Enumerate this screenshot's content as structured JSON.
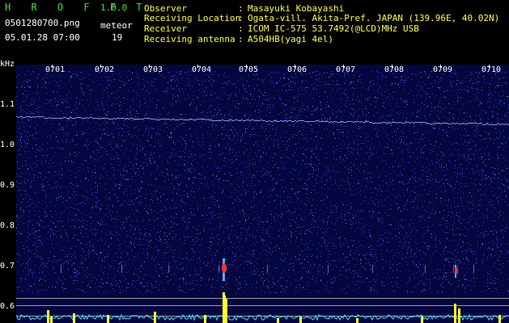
{
  "header": {
    "app_title": "H R O F F T",
    "version": "1.0.0",
    "filename": "0501280700.png",
    "datetime": "05.01.28 07:00",
    "meteor_label": "meteor",
    "meteor_count": "19",
    "fields": [
      {
        "label": "Observer",
        "sep": ":",
        "value": "Masayuki Kobayashi"
      },
      {
        "label": "Receiving Location",
        "sep": ":",
        "value": "Ogata-vill. Akita-Pref. JAPAN (139.96E, 40.02N)"
      },
      {
        "label": "Receiver",
        "sep": ":",
        "value": "ICOM IC-575 53.7492(@LCD)MHz USB"
      },
      {
        "label": "Receiving antenna",
        "sep": ":",
        "value": "A504HB(yagi 4el)"
      }
    ]
  },
  "plot": {
    "y_unit": "kHz",
    "y_ticks": [
      "1.1",
      "1.0",
      "0.9",
      "0.8",
      "0.7",
      "0.6"
    ],
    "x_ticks": [
      "0701",
      "0702",
      "0703",
      "0704",
      "0705",
      "0706",
      "0707",
      "0708",
      "0709",
      "0710"
    ],
    "colors": {
      "background": "#05063f",
      "noise": "#3b5bff",
      "echo": "#ff3030",
      "counter": "#ffff33",
      "level": "#33e6ff"
    }
  }
}
